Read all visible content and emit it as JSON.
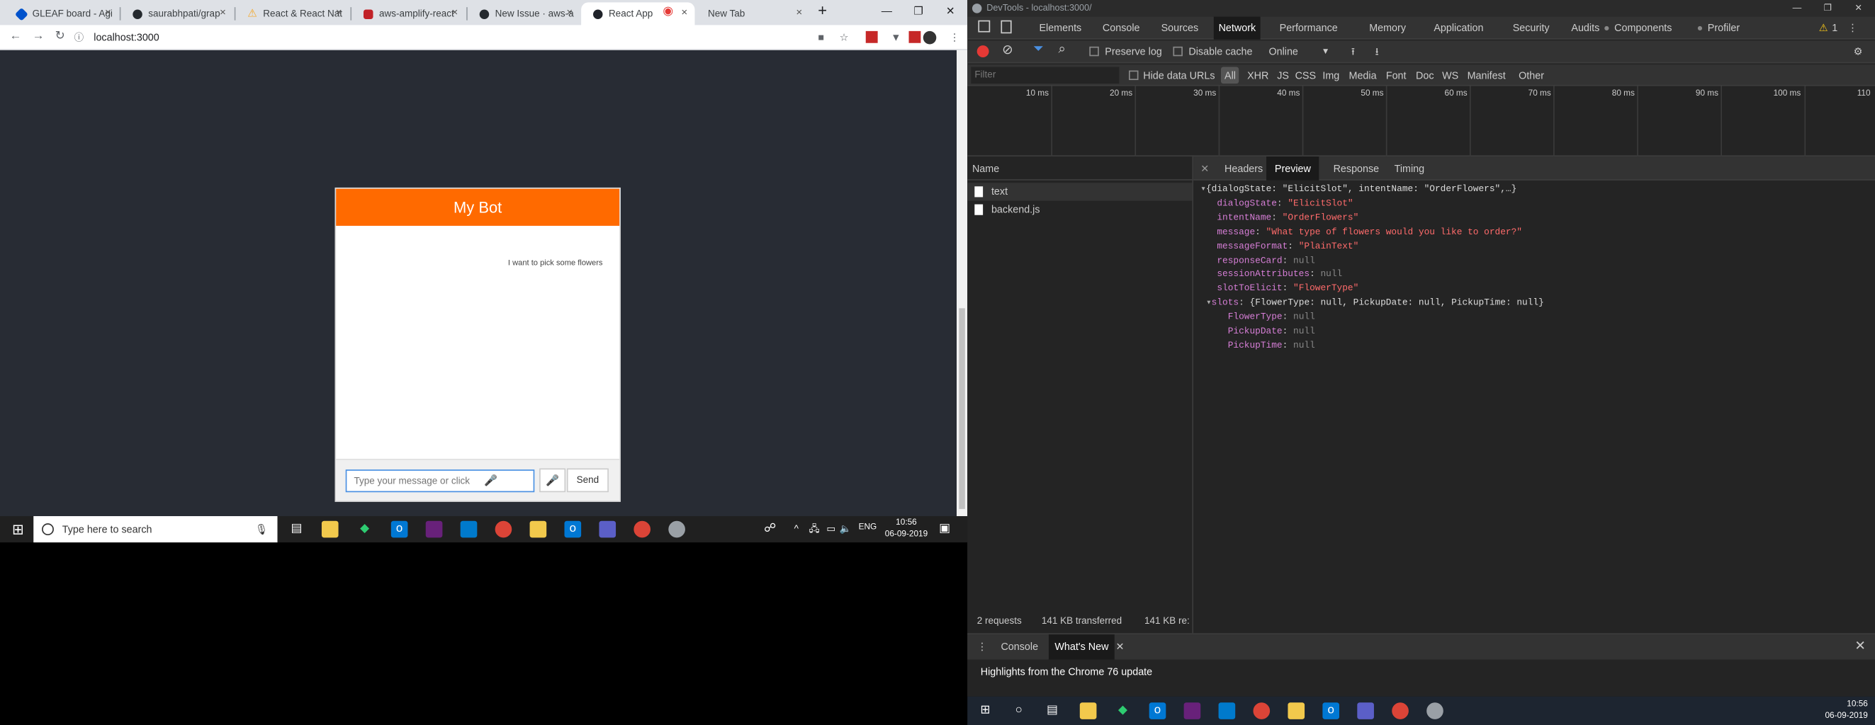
{
  "browser": {
    "tabs": [
      {
        "label": "GLEAF board - Agi",
        "icon_color": "#0052cc"
      },
      {
        "label": "saurabhpati/grap",
        "icon_color": "#24292e"
      },
      {
        "label": "React & React Nat",
        "icon_color": "#f5a623"
      },
      {
        "label": "aws-amplify-react",
        "icon_color": "#c12127"
      },
      {
        "label": "New Issue · aws-a",
        "icon_color": "#24292e"
      },
      {
        "label": "React App",
        "icon_color": "#20232a"
      },
      {
        "label": "New Tab",
        "icon_color": ""
      }
    ],
    "url": "localhost:3000"
  },
  "chat": {
    "title": "My Bot",
    "user_message": "I want to pick some flowers",
    "input_placeholder": "Type your message or click",
    "send_label": "Send",
    "accent": "#ff6a00"
  },
  "taskbar": {
    "search_text": "Type here to search",
    "lang": "ENG",
    "time": "10:56",
    "date": "06-09-2019"
  },
  "devtools": {
    "window_title": "DevTools - localhost:3000/",
    "main_tabs": [
      "Elements",
      "Console",
      "Sources",
      "Network",
      "Performance",
      "Memory",
      "Application",
      "Security",
      "Audits",
      "Components",
      "Profiler"
    ],
    "selected_main_tab": "Network",
    "warning_count": "1",
    "toolbar": {
      "preserve_log": "Preserve log",
      "disable_cache": "Disable cache",
      "throttle": "Online"
    },
    "filter_placeholder": "Filter",
    "hide_data_urls": "Hide data URLs",
    "filter_types": [
      "All",
      "XHR",
      "JS",
      "CSS",
      "Img",
      "Media",
      "Font",
      "Doc",
      "WS",
      "Manifest",
      "Other"
    ],
    "timeline_ticks": [
      "10 ms",
      "20 ms",
      "30 ms",
      "40 ms",
      "50 ms",
      "60 ms",
      "70 ms",
      "80 ms",
      "90 ms",
      "100 ms",
      "110"
    ],
    "name_header": "Name",
    "requests": [
      "text",
      "backend.js"
    ],
    "detail_tabs": [
      "Headers",
      "Preview",
      "Response",
      "Timing"
    ],
    "selected_detail_tab": "Preview",
    "preview": {
      "summary": "{dialogState: \"ElicitSlot\", intentName: \"OrderFlowers\",…}",
      "dialogState": "\"ElicitSlot\"",
      "intentName": "\"OrderFlowers\"",
      "message": "\"What type of flowers would you like to order?\"",
      "messageFormat": "\"PlainText\"",
      "responseCard": "null",
      "sessionAttributes": "null",
      "slotToElicit": "\"FlowerType\"",
      "slots_summary": "{FlowerType: null, PickupDate: null, PickupTime: null}",
      "FlowerType": "null",
      "PickupDate": "null",
      "PickupTime": "null"
    },
    "status": {
      "requests": "2 requests",
      "transferred": "141 KB transferred",
      "resources": "141 KB re:"
    },
    "drawer_tabs": [
      "Console",
      "What's New"
    ],
    "drawer_message": "Highlights from the Chrome 76 update",
    "taskbar_time": "10:56",
    "taskbar_date": "06-09-2019"
  }
}
